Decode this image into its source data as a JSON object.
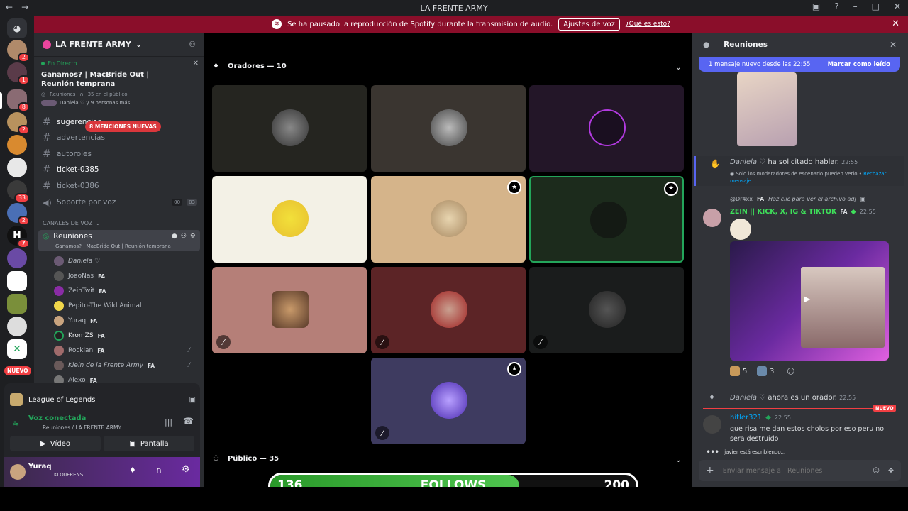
{
  "window": {
    "title": "LA FRENTE ARMY"
  },
  "banner": {
    "text": "Se ha pausado la reproducción de Spotify durante la transmisión de audio.",
    "button": "Ajustes de voz",
    "link": "¿Qué es esto?"
  },
  "rail": {
    "new_label": "NUEVO",
    "badges": [
      "2",
      "1",
      "8",
      "2",
      "33",
      "2",
      "7"
    ]
  },
  "sidebar": {
    "guild_name": "LA FRENTE ARMY",
    "event": {
      "live": "En Directo",
      "title": "Ganamos? | MacBride Out | Reunión temprana",
      "channel": "Reuniones",
      "audience": "35 en el público",
      "people": "Daniela ♡ y 9 personas más"
    },
    "mentions_pill": "8 MENCIONES NUEVAS",
    "channels": [
      {
        "name": "sugerencias"
      },
      {
        "name": "advertencias"
      },
      {
        "name": "autoroles"
      },
      {
        "name": "ticket-0385"
      },
      {
        "name": "ticket-0386"
      },
      {
        "name": "Soporte por voz",
        "c1": "00",
        "c2": "03"
      }
    ],
    "voice_category": "CANALES DE VOZ",
    "voice_channel": {
      "name": "Reuniones",
      "topic": "Ganamos? | MacBride Out | Reunión temprana"
    },
    "voice_users": [
      {
        "name": "Daniela ♡",
        "tag": ""
      },
      {
        "name": "JoaoNas",
        "tag": "FA"
      },
      {
        "name": "ZeinTwit",
        "tag": "FA"
      },
      {
        "name": "Pepito-The Wild Animal",
        "tag": ""
      },
      {
        "name": "Yuraq",
        "tag": "FA"
      },
      {
        "name": "KromZS",
        "tag": "FA"
      },
      {
        "name": "Rockian",
        "tag": "FA"
      },
      {
        "name": "Klein de la Frente Army",
        "tag": "FA"
      },
      {
        "name": "Alexo",
        "tag": "FA"
      }
    ],
    "activity": "League of Legends",
    "voice_status": {
      "title": "Voz conectada",
      "sub": "Reuniones / LA FRENTE ARMY"
    },
    "video_btn": "Vídeo",
    "screen_btn": "Pantalla",
    "user": {
      "name": "Yuraq",
      "status": "KLOuFRENS"
    }
  },
  "stage": {
    "speakers_header": "Oradores — 10",
    "audience_header": "Público — 35",
    "overlay": {
      "left": "136",
      "center": "FOLLOWS",
      "right": "200",
      "fill_fraction": 0.68
    }
  },
  "colors": {
    "banner": "#8a0e2a",
    "accent": "#5865f2",
    "green": "#23a55a"
  },
  "chat": {
    "header": "Reuniones",
    "new_messages": "1 mensaje nuevo desde las 22:55",
    "mark_read": "Marcar como leído",
    "msg1": {
      "user": "Daniela ♡",
      "text": "ha solicitado hablar.",
      "time": "22:55",
      "sub": "Solo los moderadores de escenario pueden verlo •",
      "sub_link": "Rechazar mensaje"
    },
    "reply_to": {
      "user": "@Dr4xx",
      "tag": "FA",
      "text": "Haz clic para ver el archivo adj"
    },
    "msg2": {
      "user": "ZEIN || KICK, X, IG & TIKTOK",
      "tag": "FA",
      "time": "22:55"
    },
    "reactions": [
      {
        "count": "5"
      },
      {
        "count": "3"
      }
    ],
    "msg3": {
      "user": "Daniela ♡",
      "text": "ahora es un orador.",
      "time": "22:55"
    },
    "new_tag": "NUEVO",
    "msg4": {
      "user": "hitler321",
      "time": "22:55",
      "text": "que risa me dan estos cholos por eso peru no sera destruido"
    },
    "typing": "javier está escribiendo...",
    "input_placeholder": "Enviar mensaje a   Reuniones"
  }
}
